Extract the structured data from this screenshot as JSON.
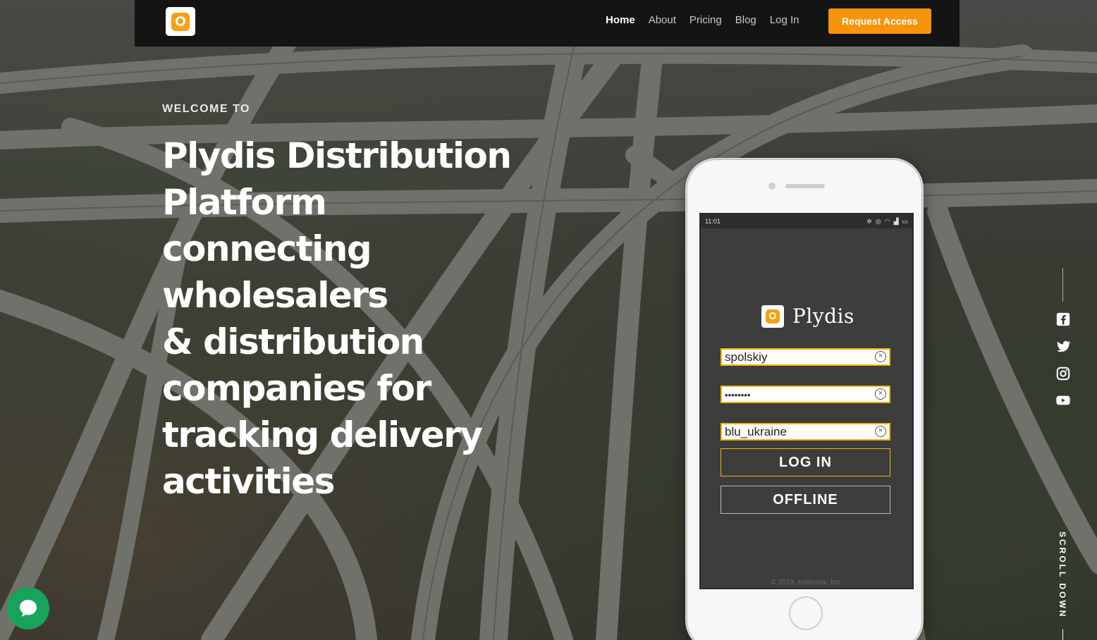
{
  "header": {
    "nav": [
      {
        "label": "Home",
        "active": true
      },
      {
        "label": "About",
        "active": false
      },
      {
        "label": "Pricing",
        "active": false
      },
      {
        "label": "Blog",
        "active": false
      },
      {
        "label": "Log In",
        "active": false
      }
    ],
    "cta_label": "Request Access"
  },
  "hero": {
    "eyebrow": "WELCOME TO",
    "headline_lines": [
      "Plydis Distribution",
      "Platform",
      "connecting",
      "wholesalers",
      "& distribution",
      "companies for",
      "tracking delivery",
      "activities"
    ]
  },
  "phone": {
    "status_time": "11:01",
    "app_name": "Plydis",
    "username": "spolskiy",
    "password": "••••••••",
    "company": "blu_ukraine",
    "login_label": "LOG IN",
    "offline_label": "OFFLINE",
    "copyright": "© 2018, Kelecorix, Inc."
  },
  "social": {
    "icons": [
      "facebook-icon",
      "twitter-icon",
      "instagram-icon",
      "youtube-icon"
    ],
    "scroll_label": "SCROLL DOWN"
  },
  "colors": {
    "accent": "#f7930c",
    "header_bg": "#141414",
    "chat": "#18a35a"
  }
}
